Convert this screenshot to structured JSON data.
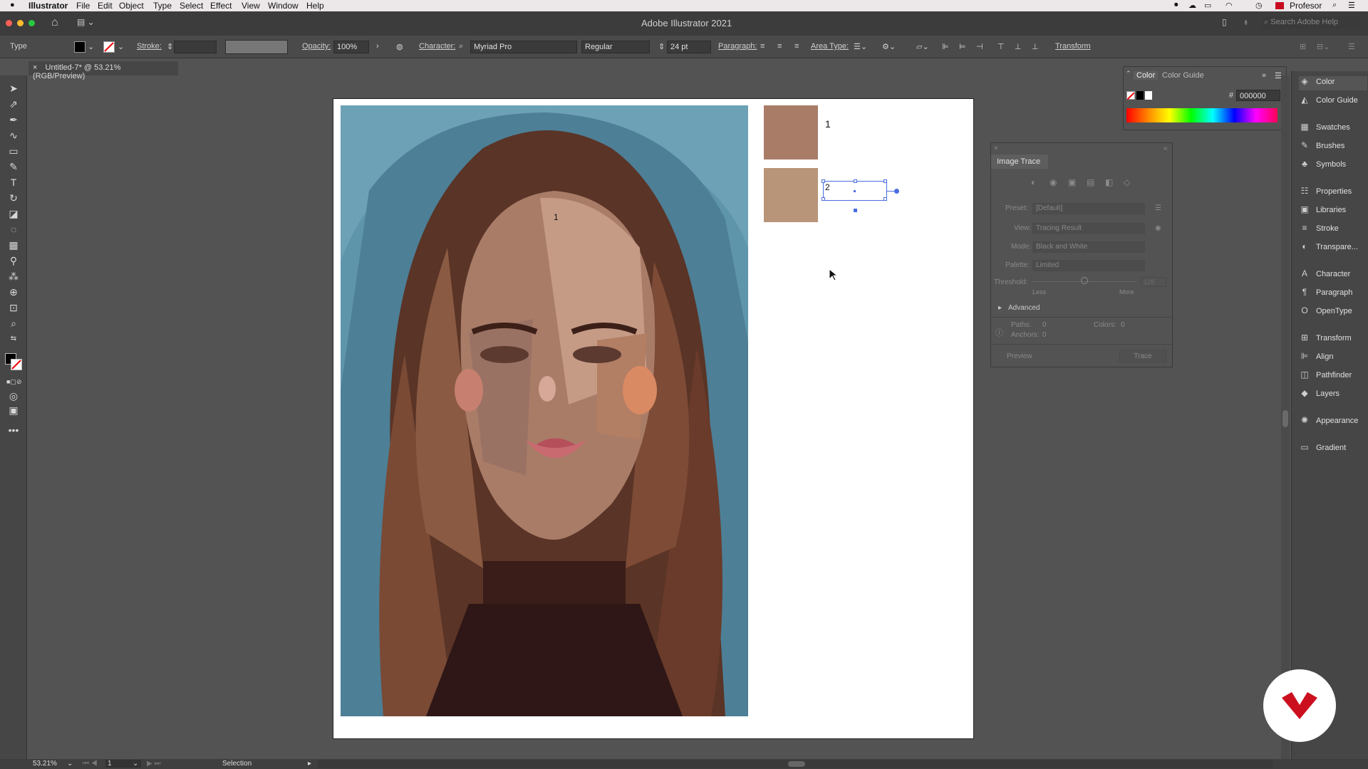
{
  "menubar": {
    "app_name": "Illustrator",
    "items": [
      "File",
      "Edit",
      "Object",
      "Type",
      "Select",
      "Effect",
      "View",
      "Window",
      "Help"
    ],
    "user": "Profesor"
  },
  "window": {
    "title": "Adobe Illustrator 2021",
    "search_placeholder": "Search Adobe Help"
  },
  "control_bar": {
    "tool_label": "Type",
    "stroke_label": "Stroke:",
    "opacity_label": "Opacity:",
    "opacity_value": "100%",
    "character_label": "Character:",
    "font_family": "Myriad Pro",
    "font_style": "Regular",
    "font_size": "24 pt",
    "paragraph_label": "Paragraph:",
    "area_type_label": "Area Type:",
    "transform_label": "Transform"
  },
  "document_tab": {
    "title": "Untitled-7* @ 53.21% (RGB/Preview)"
  },
  "canvas": {
    "swatch1_color": "#a97c68",
    "swatch1_number": "1",
    "swatch2_color": "#b89478",
    "swatch2_number": "2",
    "face_number": "1"
  },
  "image_trace": {
    "title": "Image Trace",
    "preset_label": "Preset:",
    "preset_value": "[Default]",
    "view_label": "View:",
    "view_value": "Tracing Result",
    "mode_label": "Mode:",
    "mode_value": "Black and White",
    "palette_label": "Palette:",
    "palette_value": "Limited",
    "threshold_label": "Threshold:",
    "threshold_value": "128",
    "threshold_min": "Less",
    "threshold_max": "More",
    "advanced_label": "Advanced",
    "paths_label": "Paths:",
    "paths_value": "0",
    "colors_label": "Colors:",
    "colors_value": "0",
    "anchors_label": "Anchors:",
    "anchors_value": "0",
    "preview_label": "Preview",
    "trace_button": "Trace"
  },
  "color_panel": {
    "tabs": [
      "Color",
      "Color Guide"
    ],
    "hex_symbol": "#",
    "hex_value": "000000"
  },
  "dock": {
    "items": [
      {
        "label": "Color",
        "icon": "color-icon"
      },
      {
        "label": "Color Guide",
        "icon": "color-guide-icon"
      },
      {
        "label": "Swatches",
        "icon": "swatches-icon"
      },
      {
        "label": "Brushes",
        "icon": "brushes-icon"
      },
      {
        "label": "Symbols",
        "icon": "symbols-icon"
      },
      {
        "label": "Properties",
        "icon": "properties-icon"
      },
      {
        "label": "Libraries",
        "icon": "libraries-icon"
      },
      {
        "label": "Stroke",
        "icon": "stroke-icon"
      },
      {
        "label": "Transpare...",
        "icon": "transparency-icon"
      },
      {
        "label": "Character",
        "icon": "character-icon"
      },
      {
        "label": "Paragraph",
        "icon": "paragraph-icon"
      },
      {
        "label": "OpenType",
        "icon": "opentype-icon"
      },
      {
        "label": "Transform",
        "icon": "transform-icon"
      },
      {
        "label": "Align",
        "icon": "align-icon"
      },
      {
        "label": "Pathfinder",
        "icon": "pathfinder-icon"
      },
      {
        "label": "Layers",
        "icon": "layers-icon"
      },
      {
        "label": "Appearance",
        "icon": "appearance-icon"
      },
      {
        "label": "Gradient",
        "icon": "gradient-icon"
      }
    ]
  },
  "status_bar": {
    "zoom": "53.21%",
    "artboard": "1",
    "tool": "Selection"
  }
}
